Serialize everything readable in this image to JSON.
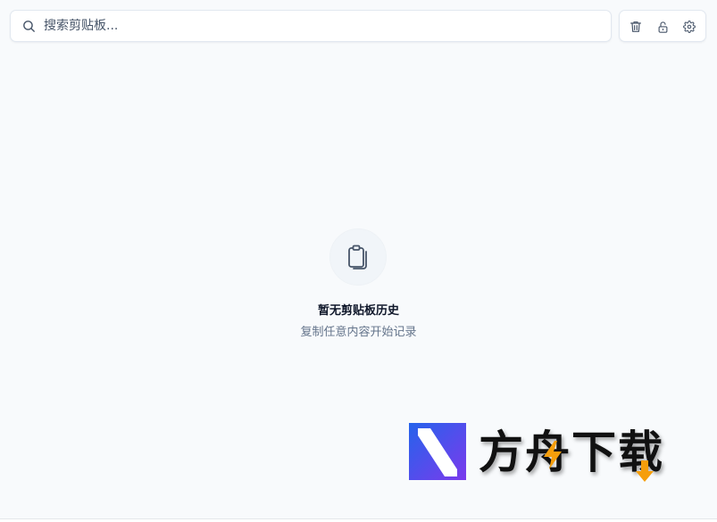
{
  "search": {
    "placeholder": "搜索剪贴板..."
  },
  "toolbar": {
    "buttons": [
      {
        "name": "clear-history",
        "icon": "trash-icon"
      },
      {
        "name": "lock",
        "icon": "lock-icon"
      },
      {
        "name": "settings",
        "icon": "gear-icon"
      }
    ]
  },
  "empty_state": {
    "icon": "clipboard-icon",
    "title": "暂无剪贴板历史",
    "subtitle": "复制任意内容开始记录"
  },
  "watermark": {
    "text": "方舟下载",
    "logo_colors": [
      "#2563eb",
      "#7c3aed",
      "#ffffff"
    ],
    "accent_color": "#f59e0b"
  },
  "colors": {
    "background": "#f8fafc",
    "border": "#e2e8f0",
    "icon": "#475569",
    "title": "#0f172a",
    "subtitle": "#64748b"
  }
}
